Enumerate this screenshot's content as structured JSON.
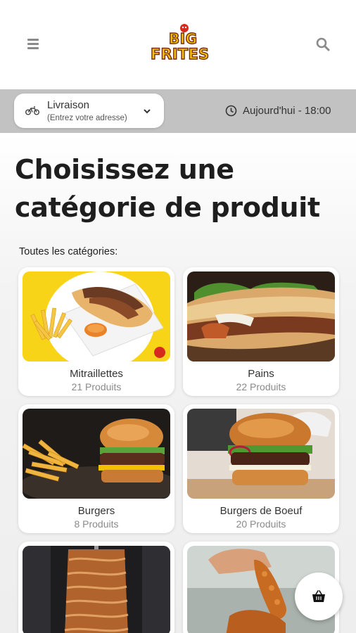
{
  "header": {
    "logo_text": "BIG FRITES",
    "menu_icon": "hamburger-menu-icon",
    "search_icon": "search-icon"
  },
  "delivery": {
    "title": "Livraison",
    "address_placeholder": "(Entrez votre adresse)",
    "icon": "bicycle-icon"
  },
  "schedule": {
    "label": "Aujourd'hui - 18:00",
    "icon": "clock-icon"
  },
  "main": {
    "title": "Choisissez une catégorie de produit",
    "section_label": "Toutes les catégories:"
  },
  "categories": [
    {
      "name": "Mitraillettes",
      "count": "21 Produits"
    },
    {
      "name": "Pains",
      "count": "22 Produits"
    },
    {
      "name": "Burgers",
      "count": "8 Produits"
    },
    {
      "name": "Burgers de Boeuf",
      "count": "20 Produits"
    },
    {
      "name": "",
      "count": ""
    },
    {
      "name": "",
      "count": ""
    }
  ],
  "cart": {
    "icon": "shopping-basket-icon"
  },
  "colors": {
    "subbar": "#c2c2c2",
    "logo_yellow": "#f5c400",
    "logo_red": "#d62a1e",
    "mitraillette_bg": "#f7d417"
  }
}
